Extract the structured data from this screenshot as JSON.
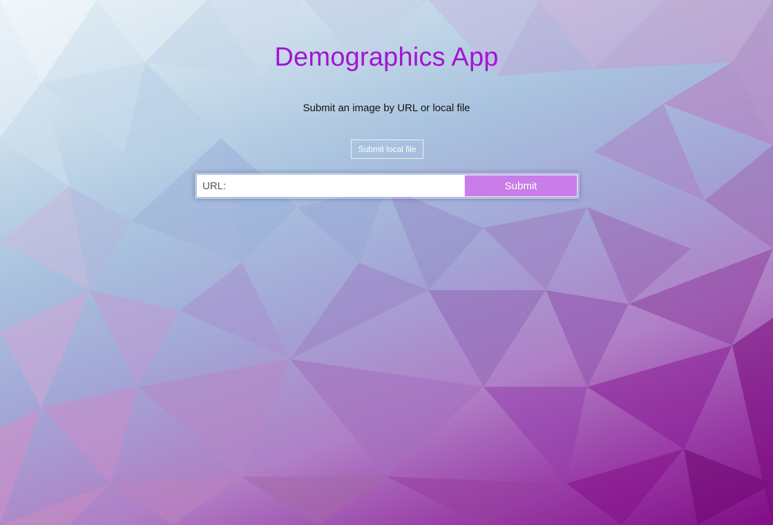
{
  "app": {
    "title": "Demographics App",
    "subtitle": "Submit an image by URL or local file"
  },
  "upload": {
    "local_file_label": "Submit local file"
  },
  "url_form": {
    "placeholder": "URL:",
    "value": "",
    "submit_label": "Submit"
  },
  "colors": {
    "title": "#a313d3",
    "submit_button": "#c87de8",
    "background_top_left": "#eef5fa",
    "background_bottom_right": "#820c86"
  }
}
